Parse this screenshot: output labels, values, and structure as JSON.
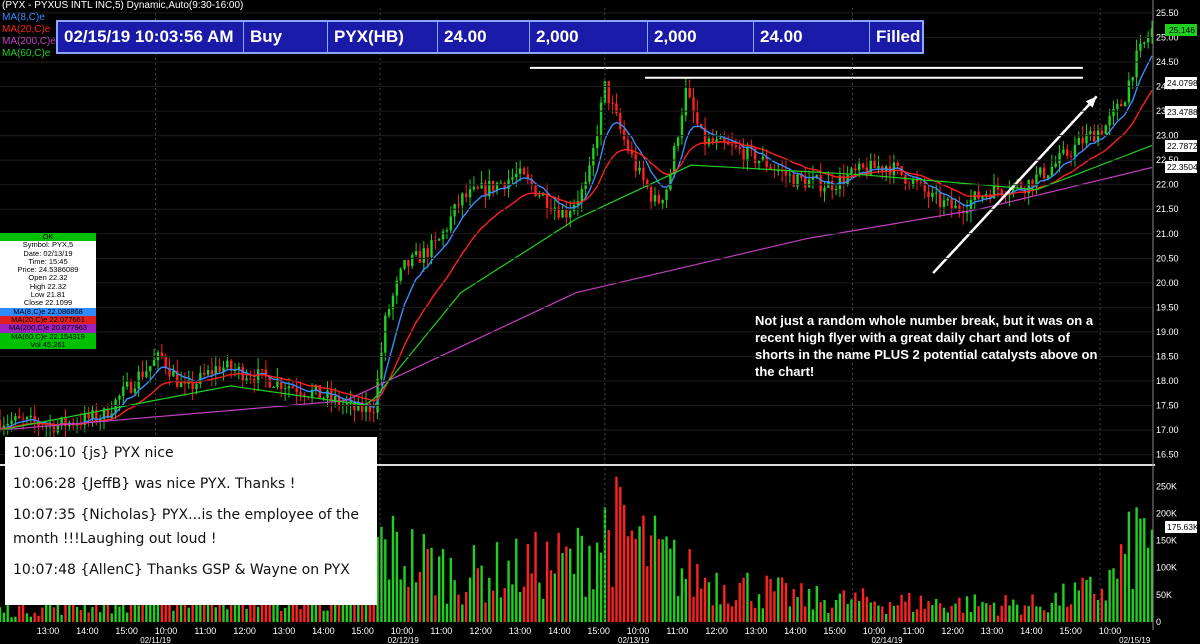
{
  "header": {
    "title": "(PYX - PYXUS INTL INC,5) Dynamic,Auto(9:30-16:00)",
    "ma_labels": [
      {
        "label": "MA(8,C)e",
        "color": "#3a8cff"
      },
      {
        "label": "MA(20,C)e",
        "color": "#ff2020"
      },
      {
        "label": "MA(200,C)e",
        "color": "#c040c0"
      },
      {
        "label": "MA(60,C)e",
        "color": "#20d020"
      }
    ]
  },
  "order": {
    "datetime": "02/15/19 10:03:56 AM",
    "side": "Buy",
    "symbol": "PYX(HB)",
    "price": "24.00",
    "qty": "2,000",
    "filled_qty": "2,000",
    "avg_price": "24.00",
    "status": "Filled"
  },
  "databox": {
    "ok": "OK",
    "rows": [
      "Symbol: PYX,5",
      "Date: 02/13/19",
      "Time: 15:45",
      "Price: 24.5386089",
      "Open 22.32",
      "High 22.32",
      "Low 21.81",
      "Close 22.1099"
    ],
    "ma_rows": [
      {
        "text": "MA(8,C)e 22.086868",
        "cls": "r-blue"
      },
      {
        "text": "MA(20,C)e 22.077661",
        "cls": "r-red"
      },
      {
        "text": "MA(200,C)e 20.877963",
        "cls": "r-purple"
      },
      {
        "text": "MA(60,C)e 22.154319",
        "cls": "r-green"
      }
    ],
    "vol": "Vol 45,261"
  },
  "annotation": "Not just a random whole number break, but it was on a recent high flyer with a great daily chart and lots of shorts in the name PLUS 2 potential catalysts above on the chart!",
  "chat": [
    "10:06:10 {js} PYX nice",
    "10:06:28 {JeffB} was nice PYX.  Thanks !",
    "10:07:35 {Nicholas} PYX...is the employee of the month !!!Laughing out loud !",
    "10:07:48 {AllenC} Thanks GSP & Wayne on PYX"
  ],
  "price_tags": [
    {
      "text": "25.146",
      "value": 25.146,
      "bg": "#20d020"
    },
    {
      "text": "24.079857",
      "value": 24.079857,
      "bg": "#ffffff"
    },
    {
      "text": "23.478836",
      "value": 23.478836,
      "bg": "#ffffff"
    },
    {
      "text": "22.787245",
      "value": 22.787245,
      "bg": "#ffffff"
    },
    {
      "text": "22.350424",
      "value": 22.350424,
      "bg": "#ffffff"
    },
    {
      "text": "175.63K",
      "value": 175630,
      "bg": "#ffffff",
      "pane": "volume"
    }
  ],
  "chart_data": [
    {
      "type": "candlestick",
      "symbol": "PYX",
      "interval": "5 min",
      "y_ticks": [
        "25.50",
        "25.00",
        "24.50",
        "24.00",
        "23.50",
        "23.00",
        "22.50",
        "22.00",
        "21.50",
        "21.00",
        "20.50",
        "20.00",
        "19.50",
        "19.00",
        "18.50",
        "18.00",
        "17.50",
        "17.00",
        "16.50"
      ],
      "ylim": [
        16.35,
        25.6
      ],
      "x_time_labels": [
        "13:00",
        "14:00",
        "15:00",
        "10:00",
        "11:00",
        "12:00",
        "13:00",
        "14:00",
        "15:00",
        "10:00",
        "11:00",
        "12:00",
        "13:00",
        "14:00",
        "15:00",
        "10:00",
        "11:00",
        "12:00",
        "13:00",
        "14:00",
        "15:00",
        "10:00",
        "11:00",
        "12:00",
        "13:00",
        "14:00",
        "15:00",
        "10:00"
      ],
      "x_date_labels": [
        "02/11/19",
        "02/12/19",
        "02/13/19",
        "02/14/19",
        "02/15/19"
      ],
      "close_path": [
        {
          "t": 0,
          "v": 17.2
        },
        {
          "t": 0.05,
          "v": 17.1
        },
        {
          "t": 0.09,
          "v": 17.3
        },
        {
          "t": 0.12,
          "v": 18.1
        },
        {
          "t": 0.14,
          "v": 18.5
        },
        {
          "t": 0.16,
          "v": 17.8
        },
        {
          "t": 0.19,
          "v": 18.3
        },
        {
          "t": 0.24,
          "v": 18.0
        },
        {
          "t": 0.28,
          "v": 17.7
        },
        {
          "t": 0.31,
          "v": 17.4
        },
        {
          "t": 0.325,
          "v": 17.5
        },
        {
          "t": 0.335,
          "v": 19.3
        },
        {
          "t": 0.35,
          "v": 20.3
        },
        {
          "t": 0.38,
          "v": 20.8
        },
        {
          "t": 0.4,
          "v": 21.7
        },
        {
          "t": 0.43,
          "v": 22.0
        },
        {
          "t": 0.45,
          "v": 22.2
        },
        {
          "t": 0.47,
          "v": 21.8
        },
        {
          "t": 0.49,
          "v": 21.4
        },
        {
          "t": 0.51,
          "v": 22.0
        },
        {
          "t": 0.525,
          "v": 24.0
        },
        {
          "t": 0.54,
          "v": 23.0
        },
        {
          "t": 0.555,
          "v": 22.2
        },
        {
          "t": 0.57,
          "v": 21.6
        },
        {
          "t": 0.58,
          "v": 22.0
        },
        {
          "t": 0.595,
          "v": 23.9
        },
        {
          "t": 0.61,
          "v": 22.9
        },
        {
          "t": 0.64,
          "v": 22.7
        },
        {
          "t": 0.66,
          "v": 22.5
        },
        {
          "t": 0.69,
          "v": 22.1
        },
        {
          "t": 0.72,
          "v": 22.0
        },
        {
          "t": 0.75,
          "v": 22.3
        },
        {
          "t": 0.77,
          "v": 22.4
        },
        {
          "t": 0.79,
          "v": 22.1
        },
        {
          "t": 0.81,
          "v": 21.7
        },
        {
          "t": 0.83,
          "v": 21.5
        },
        {
          "t": 0.86,
          "v": 21.9
        },
        {
          "t": 0.89,
          "v": 22.0
        },
        {
          "t": 0.91,
          "v": 22.3
        },
        {
          "t": 0.94,
          "v": 22.9
        },
        {
          "t": 0.96,
          "v": 23.2
        },
        {
          "t": 0.975,
          "v": 23.7
        },
        {
          "t": 0.985,
          "v": 24.5
        },
        {
          "t": 1.0,
          "v": 25.15
        }
      ],
      "moving_averages": [
        {
          "name": "MA(200,C)e",
          "color": "#c040c0",
          "points": [
            {
              "t": 0,
              "v": 17.0
            },
            {
              "t": 0.3,
              "v": 17.6
            },
            {
              "t": 0.5,
              "v": 19.8
            },
            {
              "t": 0.7,
              "v": 20.9
            },
            {
              "t": 0.85,
              "v": 21.5
            },
            {
              "t": 1.0,
              "v": 22.35
            }
          ]
        },
        {
          "name": "MA(60,C)e",
          "color": "#20d020",
          "points": [
            {
              "t": 0,
              "v": 17.0
            },
            {
              "t": 0.2,
              "v": 17.9
            },
            {
              "t": 0.32,
              "v": 17.5
            },
            {
              "t": 0.4,
              "v": 19.8
            },
            {
              "t": 0.5,
              "v": 21.3
            },
            {
              "t": 0.6,
              "v": 22.4
            },
            {
              "t": 0.75,
              "v": 22.2
            },
            {
              "t": 0.9,
              "v": 21.9
            },
            {
              "t": 1.0,
              "v": 22.8
            }
          ]
        }
      ],
      "annotations": [
        {
          "kind": "horizontal_line",
          "value": 24.38,
          "t_start": 0.46,
          "t_end": 0.94
        },
        {
          "kind": "horizontal_line",
          "value": 24.18,
          "t_start": 0.56,
          "t_end": 0.94
        },
        {
          "kind": "arrow",
          "from": {
            "t": 0.81,
            "v": 20.2
          },
          "to": {
            "t": 0.952,
            "v": 23.8
          }
        }
      ]
    },
    {
      "type": "bar",
      "series": "volume",
      "y_ticks": [
        "250K",
        "200K",
        "150K",
        "100K",
        "50K",
        "0"
      ],
      "ylim": [
        0,
        280000
      ],
      "profile": [
        {
          "t": 0,
          "v": 30000
        },
        {
          "t": 0.1,
          "v": 60000
        },
        {
          "t": 0.2,
          "v": 80000
        },
        {
          "t": 0.3,
          "v": 60000
        },
        {
          "t": 0.33,
          "v": 200000
        },
        {
          "t": 0.4,
          "v": 120000
        },
        {
          "t": 0.5,
          "v": 160000
        },
        {
          "t": 0.53,
          "v": 250000
        },
        {
          "t": 0.6,
          "v": 120000
        },
        {
          "t": 0.7,
          "v": 60000
        },
        {
          "t": 0.8,
          "v": 50000
        },
        {
          "t": 0.9,
          "v": 45000
        },
        {
          "t": 0.96,
          "v": 90000
        },
        {
          "t": 1.0,
          "v": 270000
        }
      ]
    }
  ]
}
